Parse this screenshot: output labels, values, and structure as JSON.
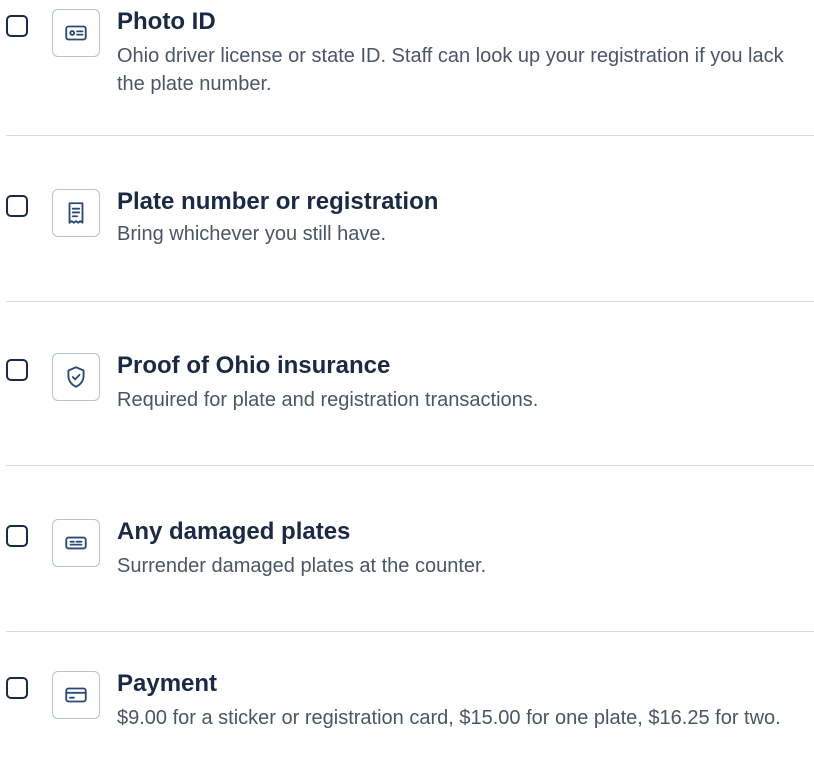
{
  "checklist": {
    "items": [
      {
        "title": "Photo ID",
        "description": "Ohio driver license or state ID. Staff can look up your registration if you lack the plate number.",
        "icon": "id-card-icon",
        "checked": false
      },
      {
        "title": "Plate number or registration",
        "description": "Bring whichever you still have.",
        "icon": "receipt-icon",
        "checked": false
      },
      {
        "title": "Proof of Ohio insurance",
        "description": "Required for plate and registration transactions.",
        "icon": "shield-check-icon",
        "checked": false
      },
      {
        "title": "Any damaged plates",
        "description": "Surrender damaged plates at the counter.",
        "icon": "license-plate-icon",
        "checked": false
      },
      {
        "title": "Payment",
        "description": "$9.00 for a sticker or registration card, $15.00 for one plate, $16.25 for two.",
        "icon": "credit-card-icon",
        "checked": false
      }
    ]
  }
}
